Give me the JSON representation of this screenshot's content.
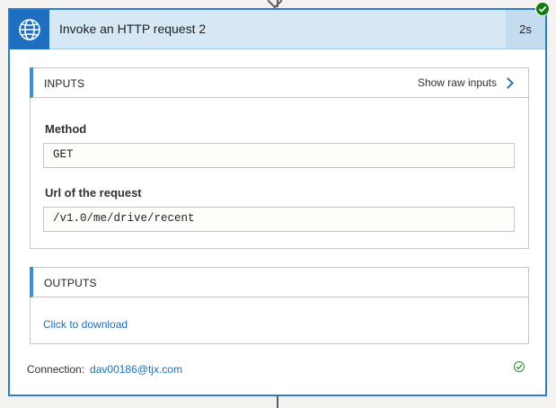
{
  "action": {
    "title": "Invoke an HTTP request 2",
    "duration": "2s",
    "header_icon": "globe-icon",
    "status": "succeeded"
  },
  "inputs": {
    "section_label": "INPUTS",
    "show_raw_label": "Show raw inputs",
    "fields": [
      {
        "label": "Method",
        "value": "GET"
      },
      {
        "label": "Url of the request",
        "value": "/v1.0/me/drive/recent"
      }
    ]
  },
  "outputs": {
    "section_label": "OUTPUTS",
    "download_label": "Click to download"
  },
  "connection": {
    "label": "Connection:",
    "value": "dav00186@tjx.com"
  },
  "colors": {
    "accent": "#1f6fc0",
    "header_bg": "#d6e8f6",
    "success": "#107c10",
    "link": "#1a6fbe"
  }
}
